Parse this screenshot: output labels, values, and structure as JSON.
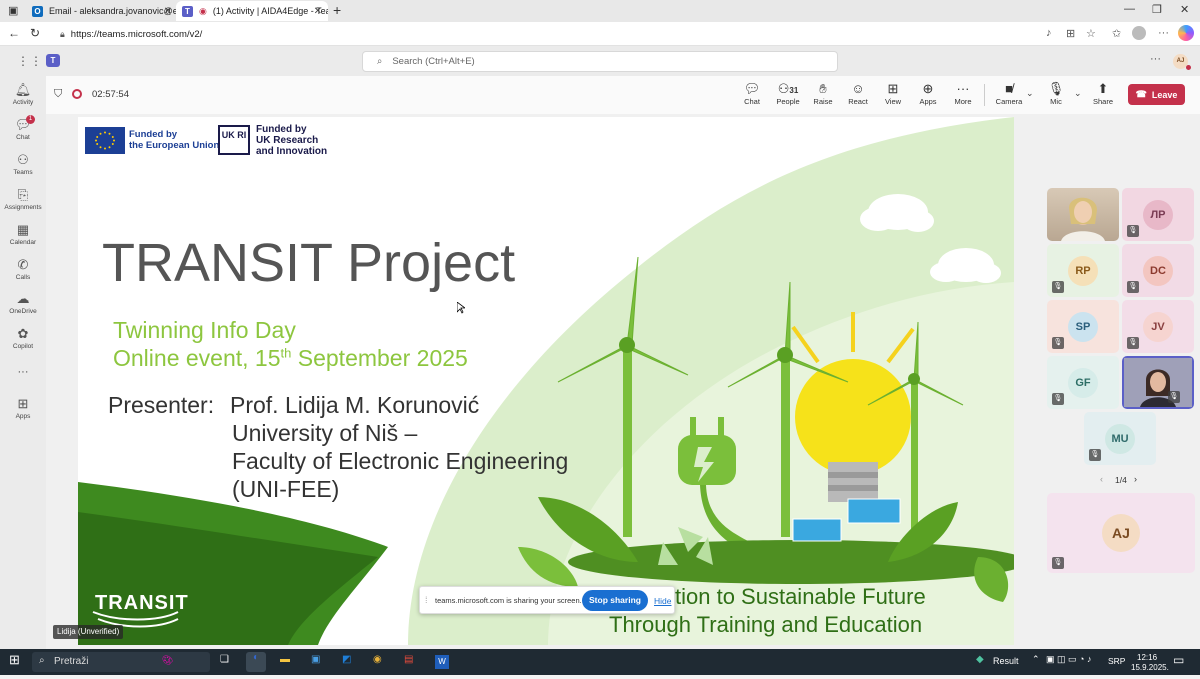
{
  "browser": {
    "tabs": [
      {
        "title": "Email - aleksandra.jovanovic@elf",
        "icon": "outlook-icon"
      },
      {
        "title": "(1) Activity | AIDA4Edge - Tea",
        "icon": "teams-icon",
        "active": true
      }
    ],
    "new_tab": "+",
    "url": "https://teams.microsoft.com/v2/"
  },
  "teams": {
    "search_placeholder": "Search (Ctrl+Alt+E)",
    "more": "···",
    "user_initials": "AJ"
  },
  "rail": [
    {
      "label": "Activity",
      "icon": "bell-icon"
    },
    {
      "label": "Chat",
      "icon": "chat-icon",
      "badge": "1"
    },
    {
      "label": "Teams",
      "icon": "teams-icon"
    },
    {
      "label": "Assignments",
      "icon": "assignments-icon"
    },
    {
      "label": "Calendar",
      "icon": "calendar-icon"
    },
    {
      "label": "Calls",
      "icon": "phone-icon"
    },
    {
      "label": "OneDrive",
      "icon": "cloud-icon"
    },
    {
      "label": "Copilot",
      "icon": "copilot-icon"
    },
    {
      "label": "···",
      "icon": "more-icon"
    },
    {
      "label": "Apps",
      "icon": "apps-icon"
    }
  ],
  "meeting": {
    "timer": "02:57:54",
    "toolbar": {
      "chat": "Chat",
      "people": "People",
      "people_count": "31",
      "raise": "Raise",
      "react": "React",
      "view": "View",
      "apps": "Apps",
      "more": "More",
      "camera": "Camera",
      "mic": "Mic",
      "share": "Share",
      "leave": "Leave"
    },
    "presenter_label": "Lidija (Unverified)",
    "sharing_notice": {
      "text": "teams.microsoft.com is sharing your screen.",
      "stop": "Stop sharing",
      "hide": "Hide"
    },
    "participants_page": "1/4",
    "participants": [
      {
        "initials": "",
        "type": "video"
      },
      {
        "initials": "ЛР",
        "bg": "#f2d7e2",
        "av": "#e8b8c8",
        "fg": "#7a3b53"
      },
      {
        "initials": "RP",
        "bg": "#e7f2e3",
        "av": "#f5e0b8",
        "fg": "#8a5a1a"
      },
      {
        "initials": "DC",
        "bg": "#f2dbe6",
        "av": "#f3c6c0",
        "fg": "#8c3a2e"
      },
      {
        "initials": "SP",
        "bg": "#f7e3dd",
        "av": "#cbe3ef",
        "fg": "#2b5f7c"
      },
      {
        "initials": "JV",
        "bg": "#f3dde8",
        "av": "#f6d4d0",
        "fg": "#8a4040"
      },
      {
        "initials": "GF",
        "bg": "#e5f1ee",
        "av": "#d6ece9",
        "fg": "#2d6e66"
      },
      {
        "initials": "",
        "type": "video2"
      },
      {
        "initials": "MU",
        "bg": "#e3eef0",
        "av": "#cfe8e4",
        "fg": "#2f6b6a"
      },
      {
        "initials": "AJ",
        "bg": "#f4e3ee",
        "av": "#f4dcc4",
        "fg": "#7a4b22"
      }
    ]
  },
  "slide": {
    "eu_line1": "Funded by",
    "eu_line2": "the European Union",
    "uk_line1": "Funded by",
    "uk_line2": "UK Research",
    "uk_line3": "and Innovation",
    "uk_logo": "UK RI",
    "title": "TRANSIT Project",
    "event_line1": "Twinning Info Day",
    "event_line2a": "Online event, 15",
    "event_sup": "th",
    "event_line2b": " September 2025",
    "presenter_label": "Presenter:",
    "presenter_name": "Prof. Lidija M. Korunović",
    "affil1": "University of Niš –",
    "affil2": "Faculty of Electronic Engineering",
    "affil3": "(UNI-FEE)",
    "tagline1": "tion to Sustainable Future",
    "tagline2": "Through Training and Education",
    "logo": "TRANSIT",
    "colors": {
      "green_text": "#8dc63f",
      "dark_green": "#3b7a1e",
      "light_green": "#d9edc5"
    }
  },
  "taskbar": {
    "search": "Pretraži",
    "result": "Result",
    "lang": "SRP",
    "time": "12:16",
    "date": "15.9.2025."
  }
}
